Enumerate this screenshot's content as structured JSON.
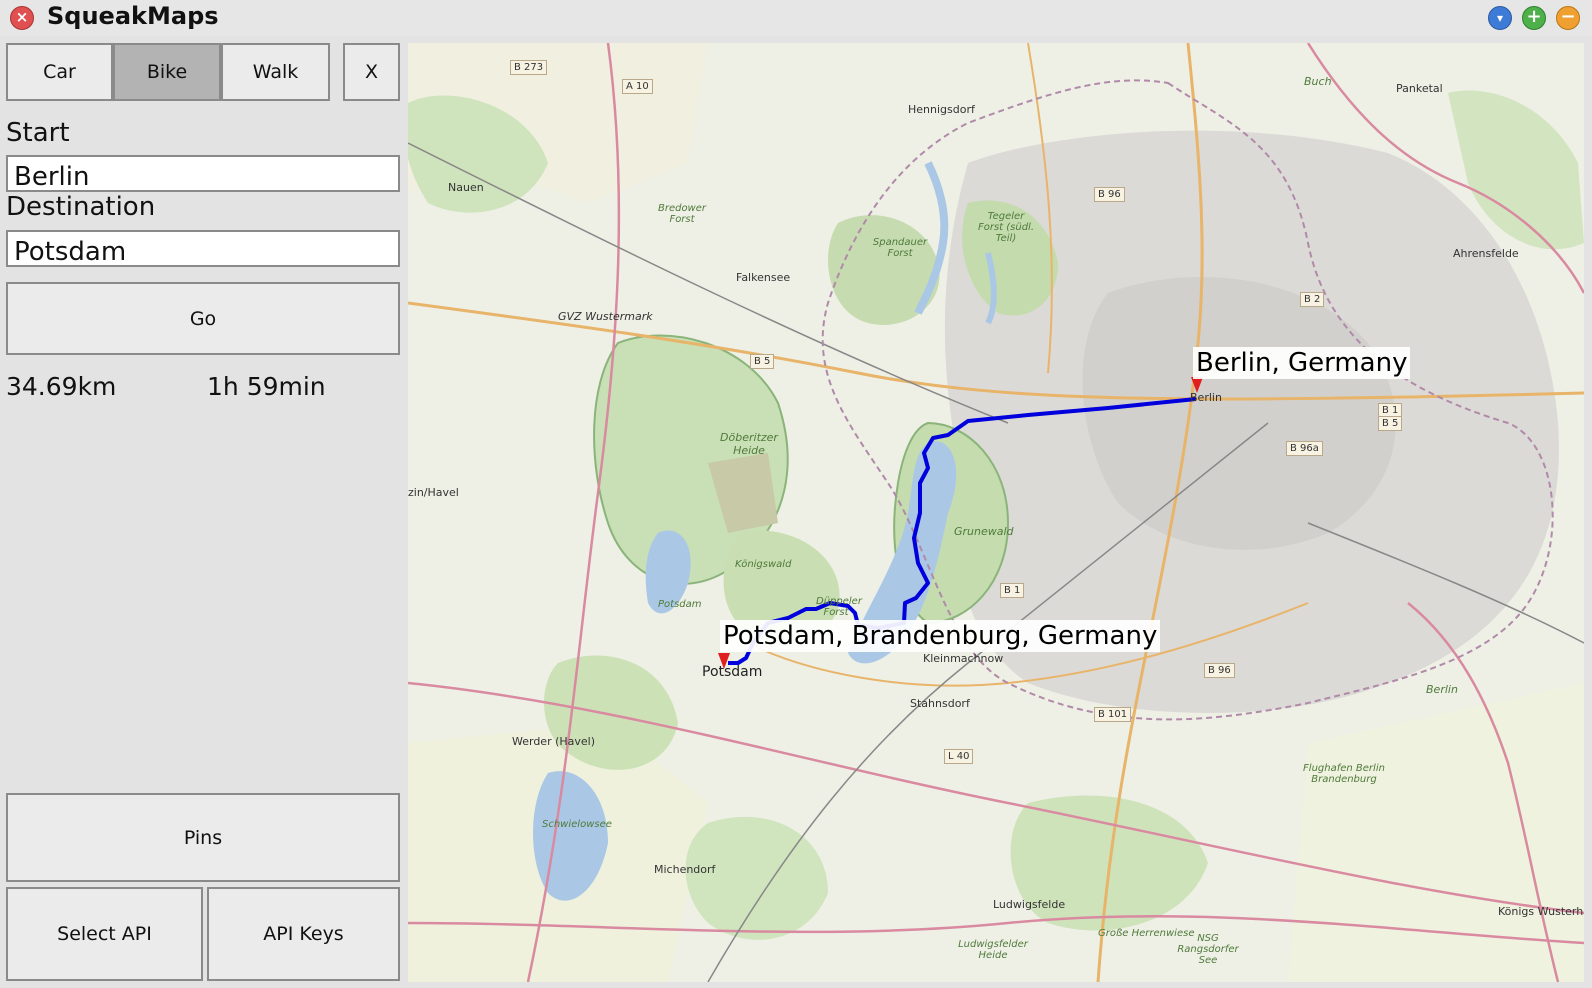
{
  "window": {
    "title": "SqueakMaps",
    "close_glyph": "×",
    "menu_glyph": "▾",
    "grow_glyph": "+",
    "shrink_glyph": "−"
  },
  "mode_buttons": {
    "car": "Car",
    "bike": "Bike",
    "walk": "Walk",
    "clear": "X",
    "active": "Bike"
  },
  "route_form": {
    "start_label": "Start",
    "start_value": "Berlin",
    "destination_label": "Destination",
    "destination_value": "Potsdam",
    "go_label": "Go"
  },
  "route_result": {
    "distance": "34.69km",
    "duration": "1h 59min"
  },
  "bottom_buttons": {
    "pins": "Pins",
    "select_api": "Select API",
    "api_keys": "API Keys"
  },
  "map": {
    "route_color": "#0000dd",
    "pin_color": "#e02020",
    "pins": [
      {
        "label": "Berlin, Germany"
      },
      {
        "label": "Potsdam, Brandenburg, Germany"
      }
    ],
    "places": {
      "hennigsdorf": "Hennigsdorf",
      "nauen": "Nauen",
      "falkensee": "Falkensee",
      "panketal": "Panketal",
      "ahrensfelde": "Ahrensfelde",
      "berlin": "Berlin",
      "potsdam": "Potsdam",
      "kleinmachnow": "Kleinmachnow",
      "stahnsdorf": "Stahnsdorf",
      "werder": "Werder (Havel)",
      "michendorf": "Michendorf",
      "ludwigsfelde": "Ludwigsfelde",
      "konigs_wusterhausen": "Königs Wusterh",
      "gvz": "GVZ Wustermark",
      "zin_havel": "zin/Havel",
      "buch": "Buch"
    },
    "areas": {
      "doberitzer": "Döberitzer Heide",
      "grunewald": "Grunewald",
      "spandauer": "Spandauer Forst",
      "tegeler": "Tegeler Forst (südl. Teil)",
      "bredower": "Bredower Forst",
      "konigswald": "Königswald",
      "dueppeler": "Düppeler Forst",
      "schwielowsee": "Schwielowsee",
      "flughafen": "Flughafen Berlin Brandenburg",
      "grosse_herrenwiese": "Große Herrenwiese",
      "nsg": "NSG Rangsdorfer See",
      "ludwigsfelder_heide": "Ludwigsfelder Heide",
      "potsdam_forest": "Potsdam",
      "berlin_se": "Berlin"
    },
    "roads": [
      "B 273",
      "A 10",
      "B 96",
      "B 2",
      "B 5",
      "B 1",
      "B 5",
      "B 96a",
      "B 1",
      "B 96",
      "B 101",
      "L 40"
    ]
  }
}
